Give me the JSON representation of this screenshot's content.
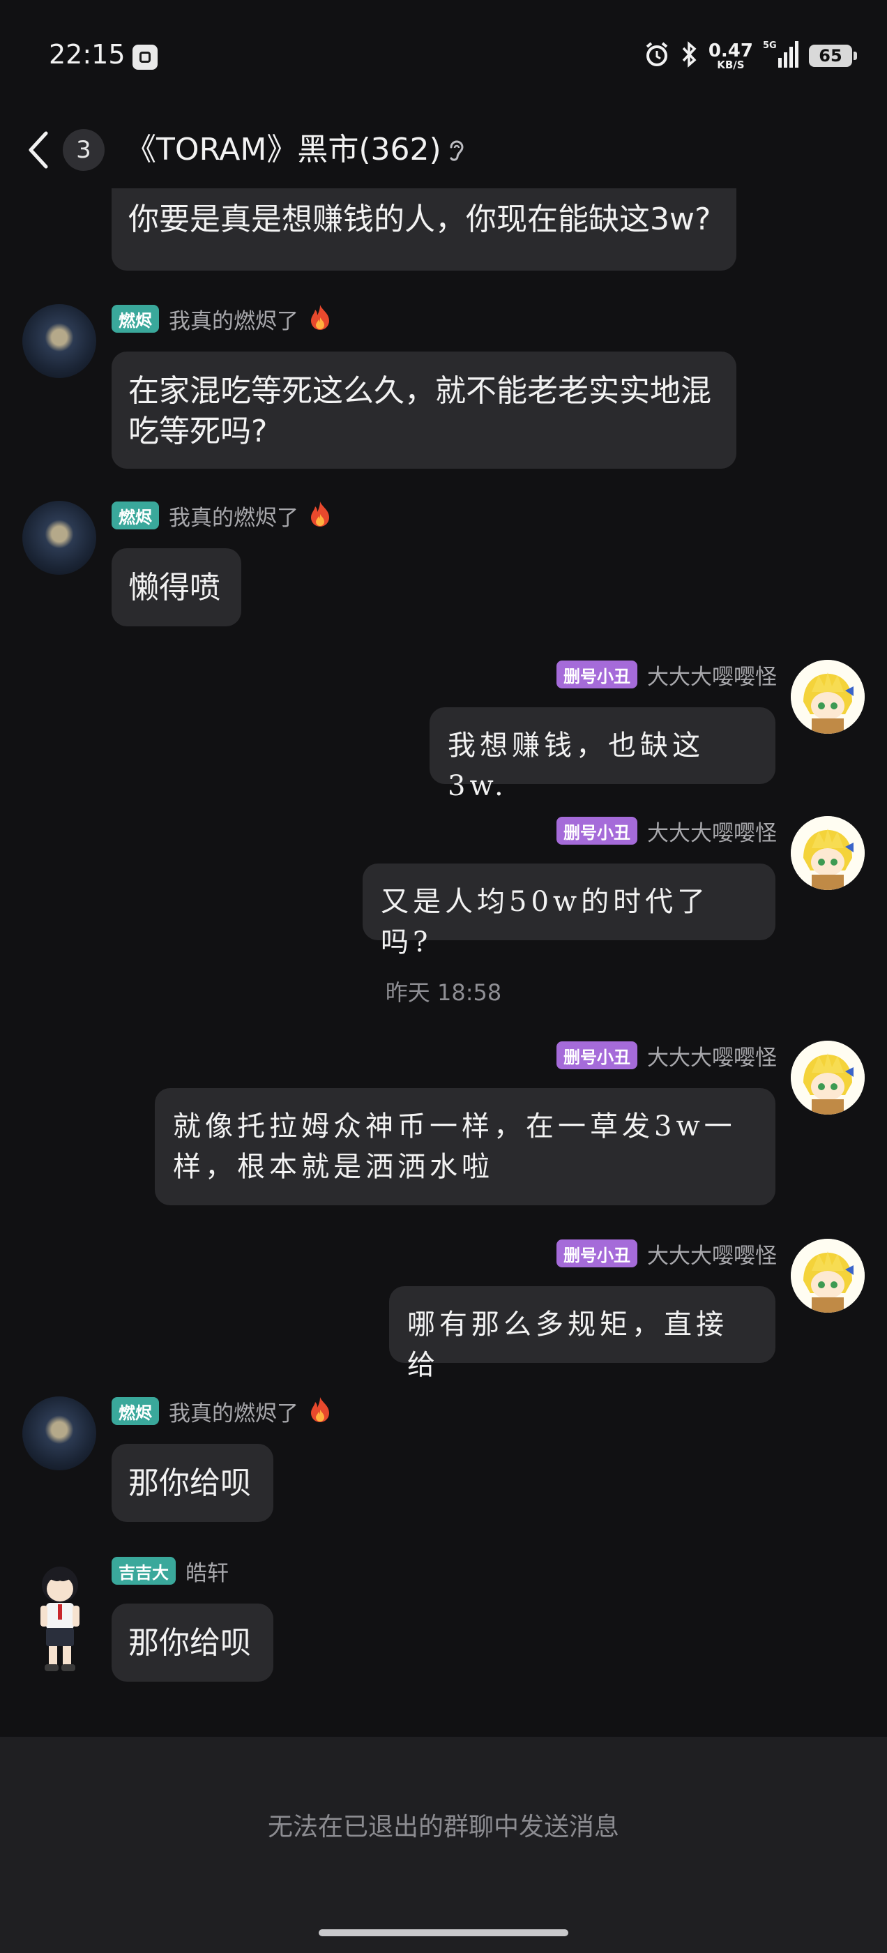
{
  "status_bar": {
    "time": "22:15",
    "net_speed_value": "0.47",
    "net_speed_unit": "KB/S",
    "network": "5G",
    "battery": "65"
  },
  "header": {
    "unread_count": "3",
    "title": "《TORAM》黑市(362)"
  },
  "messages": {
    "m0": {
      "text": "你要是真是想赚钱的人，你现在能缺这3w?"
    },
    "m1": {
      "tag": "燃烬",
      "nick": "我真的燃烬了",
      "text": "在家混吃等死这么久，就不能老老实实地混吃等死吗?"
    },
    "m2": {
      "tag": "燃烬",
      "nick": "我真的燃烬了",
      "text": "懒得喷"
    },
    "m3": {
      "tag": "删号小丑",
      "nick": "大大大嘤嘤怪",
      "text": "我想赚钱，也缺这3w."
    },
    "m4": {
      "tag": "删号小丑",
      "nick": "大大大嘤嘤怪",
      "text": "又是人均50w的时代了吗?"
    },
    "divider": "昨天 18:58",
    "m5": {
      "tag": "删号小丑",
      "nick": "大大大嘤嘤怪",
      "text": "就像托拉姆众神币一样，在一草发3w一样，根本就是洒洒水啦"
    },
    "m6": {
      "tag": "删号小丑",
      "nick": "大大大嘤嘤怪",
      "text": "哪有那么多规矩，直接给"
    },
    "m7": {
      "tag": "燃烬",
      "nick": "我真的燃烬了",
      "text": "那你给呗"
    },
    "m8": {
      "tag": "吉吉大",
      "nick": "皓轩",
      "text": "那你给呗"
    }
  },
  "footer": {
    "notice": "无法在已退出的群聊中发送消息"
  },
  "icons": [
    "alarm-icon",
    "bluetooth-icon",
    "signal-icon",
    "battery-icon",
    "back-icon",
    "ear-icon",
    "fire-icon"
  ],
  "colors": {
    "background": "#111113",
    "bubble": "#2a2a2d",
    "tag_green": "#3aa89b",
    "tag_purple": "#a56bd9"
  }
}
